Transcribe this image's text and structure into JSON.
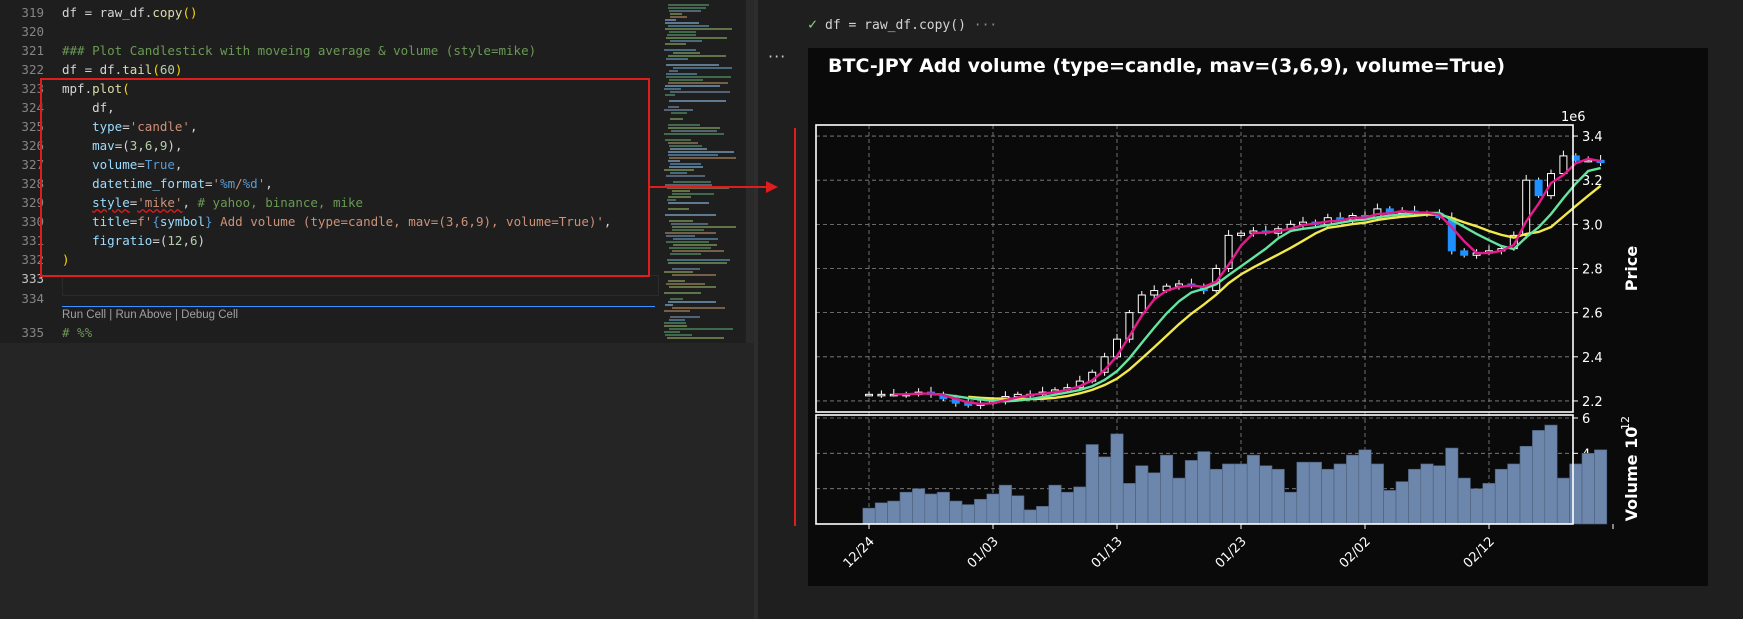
{
  "editor": {
    "lines": [
      {
        "num": "319",
        "tokens": [
          [
            "df = ",
            "plain"
          ],
          [
            "raw_df",
            "plain"
          ],
          [
            ".",
            "plain"
          ],
          [
            "copy",
            "fn"
          ],
          [
            "()",
            "br"
          ]
        ]
      },
      {
        "num": "320",
        "tokens": []
      },
      {
        "num": "321",
        "tokens": [
          [
            "### Plot Candlestick with moveing average & volume (style=mike)",
            "comment"
          ]
        ]
      },
      {
        "num": "322",
        "tokens": [
          [
            "df = df.",
            "plain"
          ],
          [
            "tail",
            "fn"
          ],
          [
            "(",
            "br"
          ],
          [
            "60",
            "num"
          ],
          [
            ")",
            "br"
          ]
        ]
      },
      {
        "num": "323",
        "tokens": [
          [
            "mpf.",
            "plain"
          ],
          [
            "plot",
            "fn"
          ],
          [
            "(",
            "br"
          ]
        ]
      },
      {
        "num": "324",
        "tokens": [
          [
            "    df,",
            "plain"
          ]
        ]
      },
      {
        "num": "325",
        "tokens": [
          [
            "    ",
            "plain"
          ],
          [
            "type",
            "var"
          ],
          [
            "=",
            "plain"
          ],
          [
            "'candle'",
            "str"
          ],
          [
            ",",
            "plain"
          ]
        ]
      },
      {
        "num": "326",
        "tokens": [
          [
            "    ",
            "plain"
          ],
          [
            "mav",
            "var"
          ],
          [
            "=",
            "plain"
          ],
          [
            "(",
            "plain"
          ],
          [
            "3",
            "num"
          ],
          [
            ",",
            "plain"
          ],
          [
            "6",
            "num"
          ],
          [
            ",",
            "plain"
          ],
          [
            "9",
            "num"
          ],
          [
            ")",
            "plain"
          ],
          [
            ",",
            "plain"
          ]
        ]
      },
      {
        "num": "327",
        "tokens": [
          [
            "    ",
            "plain"
          ],
          [
            "volume",
            "var"
          ],
          [
            "=",
            "plain"
          ],
          [
            "True",
            "kw"
          ],
          [
            ",",
            "plain"
          ]
        ]
      },
      {
        "num": "328",
        "tokens": [
          [
            "    ",
            "plain"
          ],
          [
            "datetime_format",
            "var"
          ],
          [
            "=",
            "plain"
          ],
          [
            "'",
            "str"
          ],
          [
            "%m",
            "kw"
          ],
          [
            "/",
            "str"
          ],
          [
            "%d",
            "kw"
          ],
          [
            "'",
            "str"
          ],
          [
            ",",
            "plain"
          ]
        ]
      },
      {
        "num": "329",
        "tokens": [
          [
            "    ",
            "plain"
          ],
          [
            "style",
            "var"
          ],
          [
            "=",
            "plain"
          ],
          [
            "'mike'",
            "str"
          ],
          [
            ", ",
            "plain"
          ],
          [
            "# yahoo, binance, mike",
            "comment"
          ]
        ]
      },
      {
        "num": "330",
        "tokens": [
          [
            "    ",
            "plain"
          ],
          [
            "title",
            "var"
          ],
          [
            "=",
            "plain"
          ],
          [
            "f'",
            "str"
          ],
          [
            "{",
            "kw"
          ],
          [
            "symbol",
            "var"
          ],
          [
            "}",
            "kw"
          ],
          [
            " Add volume (type=candle, mav=(3,6,9), volume=True)'",
            "str"
          ],
          [
            ",",
            "plain"
          ]
        ]
      },
      {
        "num": "331",
        "tokens": [
          [
            "    ",
            "plain"
          ],
          [
            "figratio",
            "var"
          ],
          [
            "=",
            "plain"
          ],
          [
            "(",
            "plain"
          ],
          [
            "12",
            "num"
          ],
          [
            ",",
            "plain"
          ],
          [
            "6",
            "num"
          ],
          [
            ")",
            "plain"
          ]
        ]
      },
      {
        "num": "332",
        "tokens": [
          [
            ")",
            "br"
          ]
        ]
      },
      {
        "num": "333",
        "tokens": []
      },
      {
        "num": "334",
        "tokens": []
      },
      {
        "num": "335",
        "tokens": [
          [
            "# %%",
            "comment"
          ]
        ]
      }
    ],
    "codelens": {
      "run_cell": "Run Cell",
      "run_above": "Run Above",
      "debug_cell": "Debug Cell",
      "sep": " | "
    }
  },
  "output": {
    "header_code": "df = raw_df.copy()",
    "header_ellipsis": "···",
    "more_actions": "···"
  },
  "chart_data": {
    "type": "candlestick",
    "title": "BTC-JPY Add volume (type=candle, mav=(3,6,9), volume=True)",
    "price_ylabel": "Price",
    "price_offset_label": "1e6",
    "volume_ylabel": "Volume  10",
    "volume_exponent": "12",
    "price_ylim": [
      2.15,
      3.45
    ],
    "volume_ylim": [
      0,
      6
    ],
    "price_ticks": [
      "2.2",
      "2.4",
      "2.6",
      "2.8",
      "3.0",
      "3.2",
      "3.4"
    ],
    "volume_ticks": [
      "2",
      "4",
      "6"
    ],
    "x_ticks": [
      {
        "label": "12/24",
        "index": 0
      },
      {
        "label": "01/03",
        "index": 10
      },
      {
        "label": "01/13",
        "index": 20
      },
      {
        "label": "01/23",
        "index": 30
      },
      {
        "label": "02/02",
        "index": 40
      },
      {
        "label": "02/12",
        "index": 50
      }
    ],
    "n_days": 60,
    "close": [
      2.23,
      2.23,
      2.23,
      2.23,
      2.24,
      2.23,
      2.21,
      2.19,
      2.18,
      2.19,
      2.2,
      2.22,
      2.23,
      2.23,
      2.24,
      2.25,
      2.26,
      2.29,
      2.33,
      2.4,
      2.48,
      2.6,
      2.68,
      2.7,
      2.72,
      2.73,
      2.72,
      2.7,
      2.8,
      2.95,
      2.96,
      2.97,
      2.96,
      2.98,
      3.0,
      3.01,
      3.0,
      3.03,
      3.02,
      3.04,
      3.03,
      3.07,
      3.05,
      3.06,
      3.05,
      3.05,
      3.03,
      2.88,
      2.86,
      2.87,
      2.88,
      2.89,
      2.95,
      3.2,
      3.13,
      3.23,
      3.31,
      3.29,
      3.29,
      3.28
    ],
    "volume": [
      0.9,
      1.2,
      1.3,
      1.8,
      2.0,
      1.7,
      1.8,
      1.3,
      1.1,
      1.4,
      1.7,
      2.2,
      1.6,
      0.8,
      1.0,
      2.2,
      1.8,
      2.1,
      4.5,
      3.8,
      5.1,
      2.3,
      3.3,
      2.9,
      3.9,
      2.6,
      3.6,
      4.1,
      3.1,
      3.4,
      3.4,
      3.9,
      3.3,
      3.1,
      1.8,
      3.5,
      3.5,
      3.1,
      3.4,
      3.9,
      4.2,
      3.4,
      1.9,
      2.4,
      3.1,
      3.4,
      3.3,
      4.3,
      2.6,
      2.0,
      2.3,
      3.1,
      3.4,
      4.4,
      5.3,
      5.6,
      2.6,
      3.4,
      4.0,
      4.2
    ],
    "mav_colors": {
      "mav3": "#e31b8d",
      "mav6": "#63e5a0",
      "mav9": "#f2e94e"
    },
    "up_color": "#ffffff",
    "down_color": "#1e90ff",
    "volume_color": "#6d86ab",
    "grid": true,
    "background": "#0a0a0a"
  }
}
